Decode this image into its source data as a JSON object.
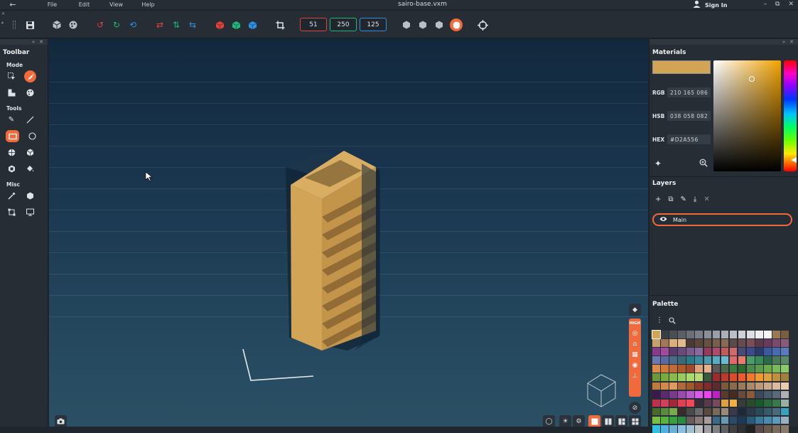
{
  "menubar": {
    "back_icon": "arrow-left-icon",
    "menus": [
      "File",
      "Edit",
      "View",
      "Help"
    ],
    "title": "sairo-base.vxm",
    "sign_in": "Sign In"
  },
  "toolbar": {
    "size_x": "51",
    "size_y": "250",
    "size_z": "125",
    "size_colors": [
      "#e0433a",
      "#1fb87a",
      "#2f8fe0"
    ]
  },
  "left_panel": {
    "title": "Toolbar",
    "sections": {
      "mode": "Mode",
      "tools": "Tools",
      "misc": "Misc"
    }
  },
  "materials": {
    "title": "Materials",
    "rgb_label": "RGB",
    "rgb_value": "210 165 086",
    "hsb_label": "HSB",
    "hsb_value": "038 058 082",
    "hex_label": "HEX",
    "hex_value": "#D2A556",
    "current_color": "#d2a556"
  },
  "layers": {
    "title": "Layers",
    "items": [
      {
        "name": "Main",
        "visible": true
      }
    ]
  },
  "palette": {
    "title": "Palette",
    "colors": [
      "#d2a556",
      "#3a3e44",
      "#4a4e55",
      "#5a5e66",
      "#6a6e76",
      "#7a7e86",
      "#8a8e96",
      "#9a9ea6",
      "#aab0b6",
      "#bcc0c6",
      "#cdd0d4",
      "#dde0e3",
      "#eceef0",
      "#f6f6f6",
      "#9a7a55",
      "#7a5e3e",
      "#c9a06a",
      "#a07a58",
      "#d9b07a",
      "#e2b98a",
      "#4a3a36",
      "#5c4638",
      "#6a5040",
      "#7a5e48",
      "#8a6a50",
      "#5a4a48",
      "#6a4a4e",
      "#7a4e58",
      "#5a3a4a",
      "#6a3a5a",
      "#7a4a6a",
      "#8a5a7a",
      "#8a3a8a",
      "#a04aa0",
      "#5a3a6a",
      "#6a4a7a",
      "#7a5a8a",
      "#8a6a9a",
      "#9a3a5a",
      "#b04a6a",
      "#c45a5a",
      "#d06a6a",
      "#4a4a7a",
      "#3a4a8a",
      "#2a3a6a",
      "#3a5aa0",
      "#4a6ab0",
      "#5a7ac0",
      "#6a7ab0",
      "#5a6aa0",
      "#4a6a8a",
      "#3a6a7a",
      "#2a7a8a",
      "#3a8aa0",
      "#4a9ab0",
      "#5aaac0",
      "#6abad0",
      "#e06a6a",
      "#ea7a6a",
      "#4a9a6a",
      "#3a8a5a",
      "#2a6a4a",
      "#4a7a5a",
      "#5a8a6a",
      "#e08a4a",
      "#d07a3a",
      "#c06a3a",
      "#b05a2a",
      "#a04a2a",
      "#e0a07a",
      "#e8b08a",
      "#5a5a5a",
      "#4a6a4a",
      "#3a7a3a",
      "#2a6a2a",
      "#4a8a4a",
      "#5a9a4a",
      "#6aaa4a",
      "#7aba5a",
      "#8aca6a",
      "#6a9a3a",
      "#7aaa3a",
      "#8aba4a",
      "#9aca5a",
      "#aada6a",
      "#bada7a",
      "#3a5a3a",
      "#a02a2a",
      "#c03a2a",
      "#e04a2a",
      "#f05a2a",
      "#f07a2a",
      "#f09a2a",
      "#e0a03a",
      "#c0903a",
      "#a0803a",
      "#c07a3a",
      "#d08a4a",
      "#e09a5a",
      "#b06a3a",
      "#a05a2a",
      "#903a2a",
      "#802a2a",
      "#602a2a",
      "#7a5a3a",
      "#8a6a4a",
      "#9a7a5a",
      "#aa8a6a",
      "#ba9a7a",
      "#caaa8a",
      "#dabba0",
      "#eaccb0",
      "#3a1a4a",
      "#5a2a6a",
      "#7a3a8a",
      "#9a4aaa",
      "#ba5aca",
      "#da5aea",
      "#f040f0",
      "#c020c0",
      "#5a3a2a",
      "#4a2a1a",
      "#6a4a3a",
      "#8a5a3a",
      "#3a4a5a",
      "#4a5a6a",
      "#5a6a7a",
      "#b0b0b0",
      "#c0304a",
      "#d0405a",
      "#a02a3a",
      "#e04050",
      "#f04a5a",
      "#3a2a3a",
      "#5a3a4a",
      "#7a4a5a",
      "#e0a040",
      "#f0b040",
      "#3a3a3a",
      "#2a4a2a",
      "#1a5a2a",
      "#2a6a3a",
      "#3a7a4a",
      "#9ab0a0",
      "#4a6a2a",
      "#5a8a3a",
      "#7aaa4a",
      "#3a2a2a",
      "#4a4a4a",
      "#6a6a6a",
      "#5a4a3a",
      "#7a6a5a",
      "#9a8a7a",
      "#3a3a4a",
      "#1a2a3a",
      "#2a3a4a",
      "#2a4a5a",
      "#3a5a6a",
      "#4a6a7a",
      "#3aa0c0",
      "#7ac040",
      "#5ab040",
      "#3aa040",
      "#2a8a40",
      "#6a5a5a",
      "#8a7a7a",
      "#aa9a9a",
      "#3a6a8a",
      "#6a9ab0",
      "#2a4a6a",
      "#1a3a5a",
      "#2a5a7a",
      "#3a7a9a",
      "#4a8aaa",
      "#5a9aba",
      "#9ab0c0",
      "#30c0e0",
      "#50b0e0",
      "#6ab0d0",
      "#8ac0e0",
      "#a0c0d0",
      "#c0c0c0",
      "#a0a0a0",
      "#808080",
      "#606060",
      "#404040",
      "#303030",
      "#202020",
      "#5a4a4a",
      "#6a5a4a",
      "#7a6a5a",
      "#8a7a6a"
    ]
  },
  "viewport": {
    "viewmode": "HIGH"
  }
}
